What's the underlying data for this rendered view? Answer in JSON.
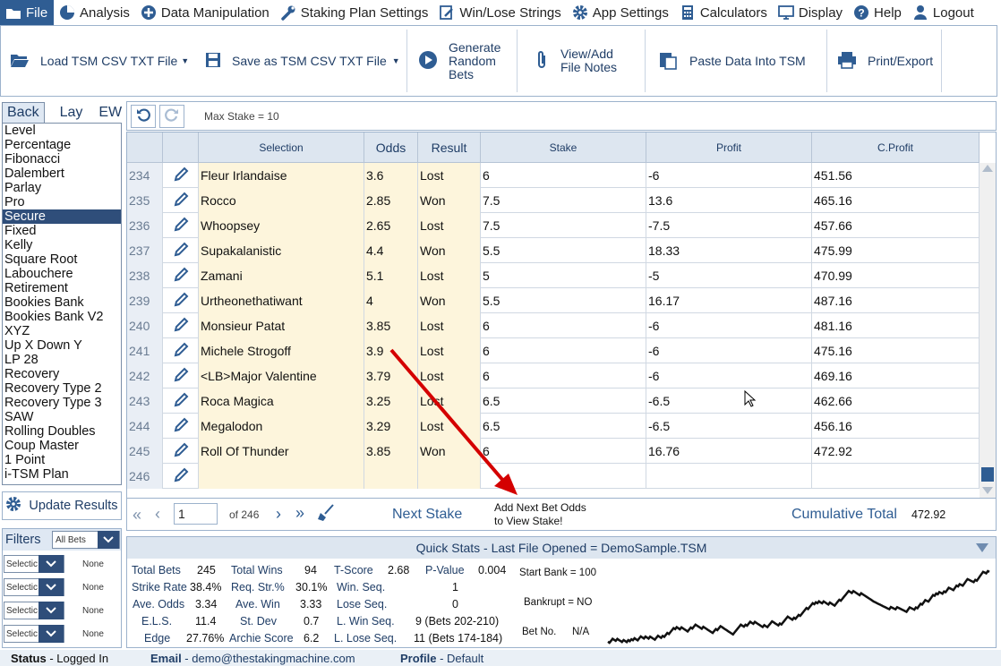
{
  "menu": [
    {
      "label": "File",
      "icon": "folder-icon",
      "active": true
    },
    {
      "label": "Analysis",
      "icon": "pie-chart-icon"
    },
    {
      "label": "Data Manipulation",
      "icon": "plus-circle-icon"
    },
    {
      "label": "Staking Plan Settings",
      "icon": "wrench-icon"
    },
    {
      "label": "Win/Lose Strings",
      "icon": "edit-document-icon"
    },
    {
      "label": "App Settings",
      "icon": "gear-icon"
    },
    {
      "label": "Calculators",
      "icon": "calculator-icon"
    },
    {
      "label": "Display",
      "icon": "monitor-icon"
    },
    {
      "label": "Help",
      "icon": "help-icon"
    },
    {
      "label": "Logout",
      "icon": "user-icon"
    }
  ],
  "ribbon": {
    "load": "Load TSM CSV TXT File",
    "save": "Save as TSM CSV TXT File",
    "generate": [
      "Generate",
      "Random",
      "Bets"
    ],
    "notes": [
      "View/Add",
      "File Notes"
    ],
    "paste": "Paste Data Into TSM",
    "print": "Print/Export"
  },
  "tabs": [
    "Back",
    "Lay",
    "EW"
  ],
  "plans": [
    "Level",
    "Percentage",
    "Fibonacci",
    "Dalembert",
    "Parlay",
    "Pro",
    "Secure",
    "Fixed",
    "Kelly",
    "Square Root",
    "Labouchere",
    "Retirement",
    "Bookies Bank",
    "Bookies Bank V2",
    "XYZ",
    "Up X Down Y",
    "LP 28",
    "Recovery",
    "Recovery Type 2",
    "Recovery Type 3",
    "SAW",
    "Rolling Doubles",
    "Coup Master",
    "1 Point",
    "i-TSM Plan"
  ],
  "selected_plan": "Secure",
  "update_label": "Update Results",
  "filters": {
    "label": "Filters",
    "all": "All Bets",
    "rows": [
      {
        "sel": "Selectic",
        "val": "None"
      },
      {
        "sel": "Selectic",
        "val": "None"
      },
      {
        "sel": "Selectic",
        "val": "None"
      },
      {
        "sel": "Selectic",
        "val": "None"
      }
    ]
  },
  "max_stake": "Max Stake = 10",
  "columns": [
    "Selection",
    "Odds",
    "Result",
    "Stake",
    "Profit",
    "C.Profit"
  ],
  "rows": [
    {
      "n": "234",
      "sel": "Fleur Irlandaise",
      "odds": "3.6",
      "res": "Lost",
      "stake": "6",
      "profit": "-6",
      "cp": "451.56"
    },
    {
      "n": "235",
      "sel": "Rocco",
      "odds": "2.85",
      "res": "Won",
      "stake": "7.5",
      "profit": "13.6",
      "cp": "465.16"
    },
    {
      "n": "236",
      "sel": "Whoopsey",
      "odds": "2.65",
      "res": "Lost",
      "stake": "7.5",
      "profit": "-7.5",
      "cp": "457.66"
    },
    {
      "n": "237",
      "sel": "Supakalanistic",
      "odds": "4.4",
      "res": "Won",
      "stake": "5.5",
      "profit": "18.33",
      "cp": "475.99"
    },
    {
      "n": "238",
      "sel": "Zamani",
      "odds": "5.1",
      "res": "Lost",
      "stake": "5",
      "profit": "-5",
      "cp": "470.99"
    },
    {
      "n": "239",
      "sel": "Urtheonethatiwant",
      "odds": "4",
      "res": "Won",
      "stake": "5.5",
      "profit": "16.17",
      "cp": "487.16"
    },
    {
      "n": "240",
      "sel": "Monsieur Patat",
      "odds": "3.85",
      "res": "Lost",
      "stake": "6",
      "profit": "-6",
      "cp": "481.16"
    },
    {
      "n": "241",
      "sel": "Michele Strogoff",
      "odds": "3.9",
      "res": "Lost",
      "stake": "6",
      "profit": "-6",
      "cp": "475.16"
    },
    {
      "n": "242",
      "sel": "<LB>Major Valentine",
      "odds": "3.79",
      "res": "Lost",
      "stake": "6",
      "profit": "-6",
      "cp": "469.16"
    },
    {
      "n": "243",
      "sel": "Roca Magica",
      "odds": "3.25",
      "res": "Lost",
      "stake": "6.5",
      "profit": "-6.5",
      "cp": "462.66"
    },
    {
      "n": "244",
      "sel": "Megalodon",
      "odds": "3.29",
      "res": "Lost",
      "stake": "6.5",
      "profit": "-6.5",
      "cp": "456.16"
    },
    {
      "n": "245",
      "sel": "Roll Of Thunder",
      "odds": "3.85",
      "res": "Won",
      "stake": "6",
      "profit": "16.76",
      "cp": "472.92"
    },
    {
      "n": "246",
      "sel": "",
      "odds": "",
      "res": "",
      "stake": "",
      "profit": "",
      "cp": ""
    }
  ],
  "pager": {
    "page": "1",
    "of": "of 246",
    "next_stake": "Next Stake",
    "hint": [
      "Add Next Bet Odds",
      "to View Stake!"
    ],
    "cum_label": "Cumulative Total",
    "cum_value": "472.92"
  },
  "quickstats": {
    "title": "Quick Stats - Last File Opened = DemoSample.TSM",
    "total_bets_l": "Total Bets",
    "total_bets": "245",
    "total_wins_l": "Total Wins",
    "total_wins": "94",
    "tscore_l": "T-Score",
    "tscore": "2.68",
    "pvalue_l": "P-Value",
    "pvalue": "0.004",
    "strike_l": "Strike Rate",
    "strike": "38.4%",
    "reqstr_l": "Req. Str.%",
    "reqstr": "30.1%",
    "winseq_l": "Win. Seq.",
    "winseq": "1",
    "aveodds_l": "Ave. Odds",
    "aveodds": "3.34",
    "avewin_l": "Ave. Win",
    "avewin": "3.33",
    "loseseq_l": "Lose Seq.",
    "loseseq": "0",
    "els_l": "E.L.S.",
    "els": "11.4",
    "stdev_l": "St. Dev",
    "stdev": "0.7",
    "lwinseq_l": "L. Win Seq.",
    "lwinseq": "9 (Bets 202-210)",
    "edge_l": "Edge",
    "edge": "27.76%",
    "archie_l": "Archie Score",
    "archie": "6.2",
    "lloseseq_l": "L. Lose Seq.",
    "lloseseq": "11 (Bets 174-184)",
    "startbank": "Start Bank = 100",
    "bankrupt": "Bankrupt = NO",
    "betno_l": "Bet No.",
    "betno": "N/A"
  },
  "status": {
    "status_l": "Status",
    "status": " - Logged In",
    "email_l": "Email",
    "email": " - demo@thestakingmachine.com",
    "profile_l": "Profile",
    "profile": " - Default"
  },
  "colors": {
    "accent": "#2f5d93",
    "arrow": "#d40000"
  }
}
